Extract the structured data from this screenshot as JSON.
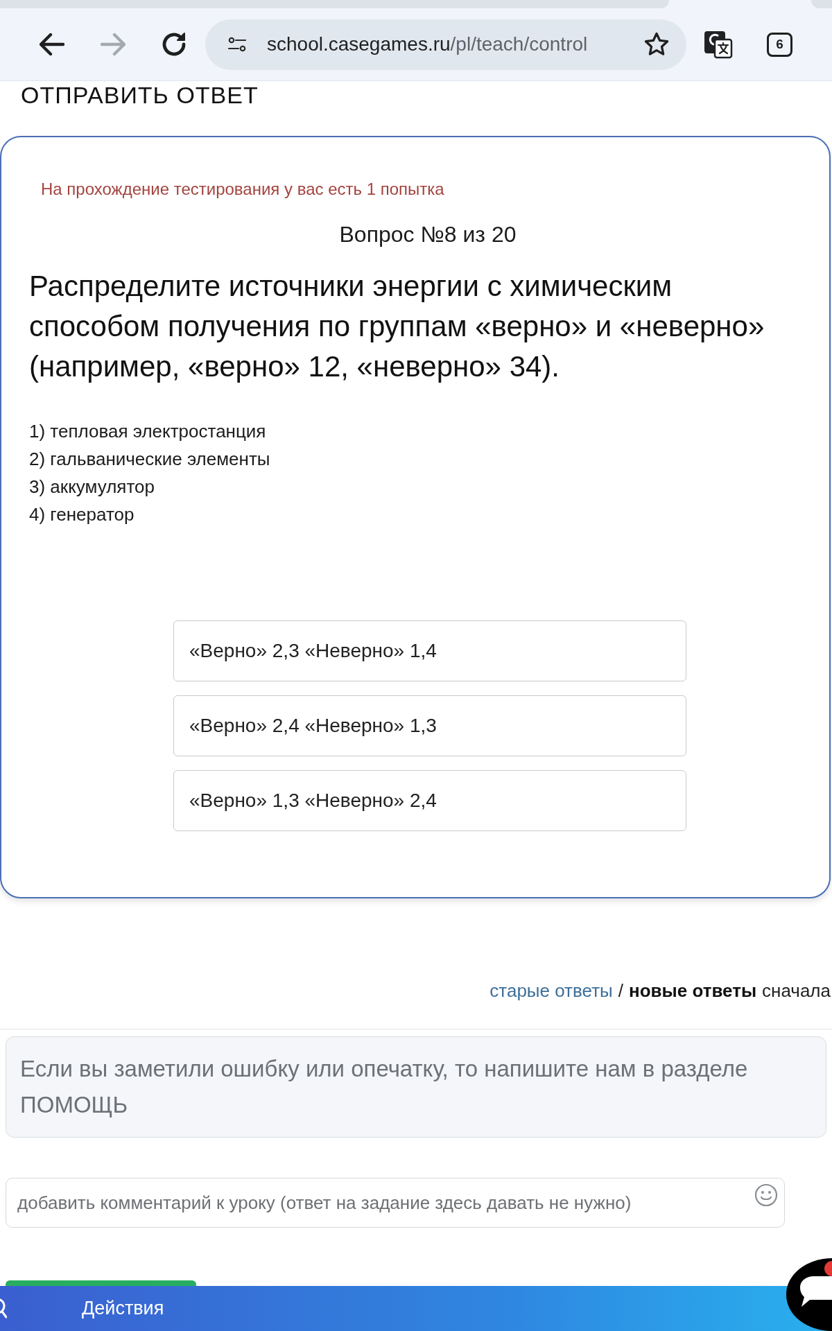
{
  "browser": {
    "nav": [
      {
        "kind": "back",
        "disabled": false
      },
      {
        "kind": "forward",
        "disabled": true
      },
      {
        "kind": "reload",
        "disabled": false
      }
    ],
    "url": {
      "host": "school.casegames.ru",
      "path": "/pl/teach/control"
    },
    "bookmarked": false,
    "tab_count": "6"
  },
  "submit_button": "ОТПРАВИТЬ ОТВЕТ",
  "test": {
    "attempts_notice": "На прохождение тестирования у вас есть 1 попытка",
    "question_number": "Вопрос №8 из 20",
    "question": "Распределите источники энергии с химическим способом получения по группам «верно» и «неверно» (например, «верно» 12, «неверно» 34).",
    "items": [
      "1) тепловая электростанция",
      "2) гальванические элементы",
      "3) аккумулятор",
      "4) генератор"
    ],
    "options": [
      {
        "label": "«Верно» 2,3 «Неверно» 1,4",
        "selected": false
      },
      {
        "label": "«Верно» 2,4 «Неверно» 1,3",
        "selected": false
      },
      {
        "label": "«Верно» 1,3 «Неверно» 2,4",
        "selected": false
      }
    ]
  },
  "answers_sort": {
    "options": [
      {
        "label": "старые ответы",
        "selected": false
      },
      {
        "label": "новые ответы",
        "selected": true
      }
    ],
    "separator": "/",
    "suffix": "сначала"
  },
  "error_notice": "Если вы заметили ошибку или опечатку, то напишите нам в разделе ПОМОЩЬ",
  "comment": {
    "placeholder": "добавить комментарий к уроку (ответ на задание здесь давать не нужно)"
  },
  "bottom_bar": {
    "label": "Действия",
    "chat_unread": true
  }
}
